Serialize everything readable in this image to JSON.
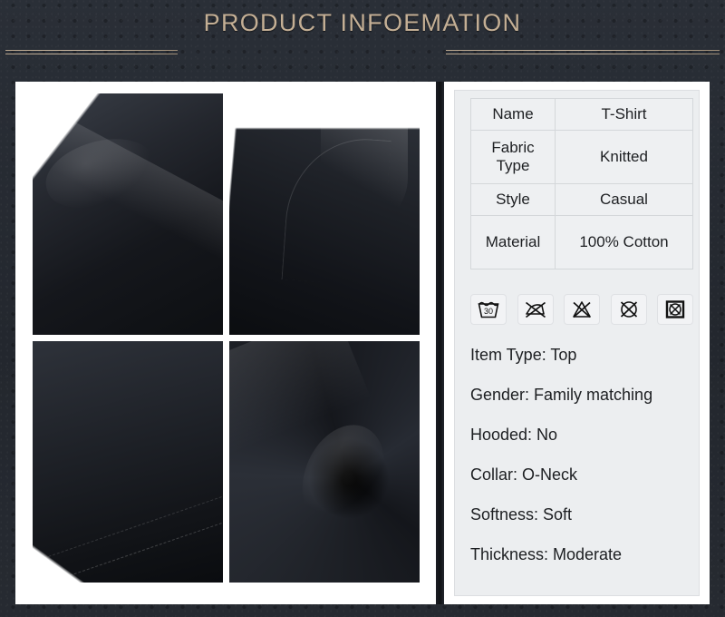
{
  "header": {
    "title": "PRODUCT INFOEMATION",
    "title_color": "#c4af95",
    "background_color": "#24282f"
  },
  "gallery": {
    "photos": [
      {
        "name": "shoulder-seam-closeup",
        "alt": "Black t-shirt shoulder and collar seam closeup"
      },
      {
        "name": "neckline-collar-closeup",
        "alt": "Black t-shirt crew neckline collar closeup"
      },
      {
        "name": "hem-stitching-closeup",
        "alt": "Black t-shirt hem stitching detail"
      },
      {
        "name": "fabric-texture-swirl",
        "alt": "Black cotton fabric swirled texture closeup"
      }
    ]
  },
  "spec_table": {
    "rows": [
      {
        "label": "Name",
        "value": "T-Shirt"
      },
      {
        "label": "Fabric Type",
        "value": "Knitted"
      },
      {
        "label": "Style",
        "value": "Casual"
      },
      {
        "label": "Material",
        "value": "100% Cotton"
      }
    ]
  },
  "care_symbols": [
    {
      "name": "wash-30-icon",
      "label": "Machine wash at 30 degrees",
      "temperature": "30"
    },
    {
      "name": "do-not-iron-icon",
      "label": "Do not iron"
    },
    {
      "name": "do-not-bleach-icon",
      "label": "Do not bleach"
    },
    {
      "name": "do-not-dry-clean-icon",
      "label": "Do not dry clean"
    },
    {
      "name": "do-not-tumble-dry-icon",
      "label": "Do not tumble dry"
    }
  ],
  "attributes": [
    "Item Type: Top",
    "Gender: Family matching",
    "Hooded: No",
    "Collar: O-Neck",
    "Softness: Soft",
    "Thickness: Moderate"
  ]
}
